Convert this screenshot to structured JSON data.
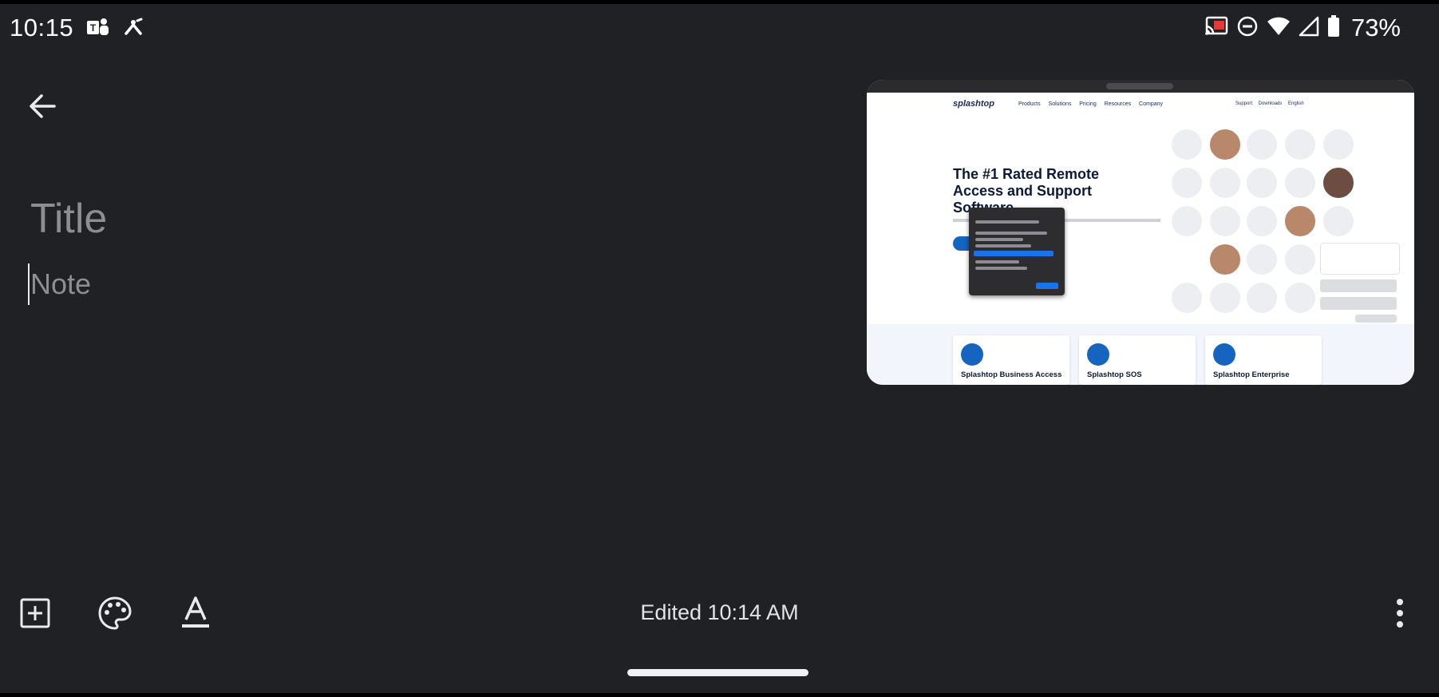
{
  "status_bar": {
    "time": "10:15",
    "left_icons": [
      "teams-icon",
      "splashtop-icon"
    ],
    "right_icons": [
      "cast-icon",
      "do-not-disturb-icon",
      "wifi-icon",
      "cell-signal-icon",
      "battery-icon"
    ],
    "battery_percent": "73%"
  },
  "note": {
    "title_placeholder": "Title",
    "body_placeholder": "Note",
    "title_value": "",
    "body_value": ""
  },
  "attachment": {
    "type": "screenshot",
    "hero_heading": "The #1 Rated Remote Access and Support Software",
    "nav_logo": "splashtop",
    "nav_links": "Products Solutions Pricing Resources Company",
    "nav_right": "Support Downloads English",
    "cards": [
      {
        "label": "Splashtop Business Access"
      },
      {
        "label": "Splashtop SOS"
      },
      {
        "label": "Splashtop Enterprise"
      }
    ]
  },
  "toolbar": {
    "add_icon": "add-box-icon",
    "palette_icon": "palette-icon",
    "format_icon": "text-format-icon",
    "edited_text": "Edited 10:14 AM",
    "more_icon": "more-vert-icon"
  },
  "colors": {
    "background": "#202124",
    "text": "#e8eaed",
    "placeholder": "#8c8e91",
    "accent_blue": "#1565c0"
  }
}
